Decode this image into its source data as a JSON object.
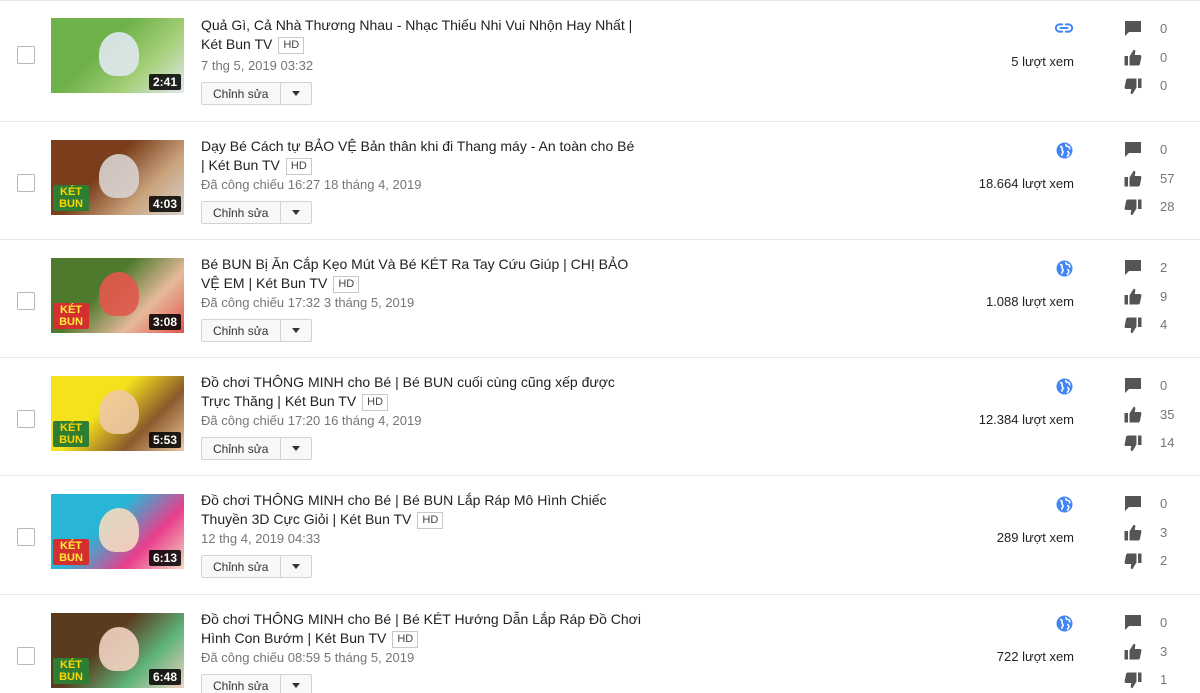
{
  "ui": {
    "edit_label": "Chỉnh sửa",
    "hd_badge": "HD",
    "accent_color": "#4285f4",
    "icon_color": "#555555"
  },
  "videos": [
    {
      "title": "Quả Gì, Cả Nhà Thương Nhau - Nhạc Thiếu Nhi Vui Nhộn Hay Nhất | Két Bun TV",
      "hd": true,
      "date": "7 thg 5, 2019 03:32",
      "duration": "2:41",
      "visibility": "unlisted",
      "visibility_icon": "link-icon",
      "views": "5 lượt xem",
      "comments": "0",
      "likes": "0",
      "dislikes": "0",
      "thumb_colors": [
        "#6fb24a",
        "#a7d07a",
        "#e0e8f0"
      ],
      "logo": ""
    },
    {
      "title": "Dạy Bé Cách tự BẢO VỆ Bản thân khi đi Thang máy - An toàn cho Bé | Két Bun TV",
      "hd": true,
      "date": "Đã công chiếu 16:27 18 tháng 4, 2019",
      "duration": "4:03",
      "visibility": "public",
      "visibility_icon": "globe-icon",
      "views": "18.664 lượt xem",
      "comments": "0",
      "likes": "57",
      "dislikes": "28",
      "thumb_colors": [
        "#7a3e1c",
        "#c9a27b",
        "#d8d3cf"
      ],
      "logo": "KÉT BUN"
    },
    {
      "title": "Bé BUN Bị Ăn Cắp Kẹo Mút Và Bé KÉT Ra Tay Cứu Giúp | CHỊ BẢO VỆ EM | Két Bun TV",
      "hd": true,
      "date": "Đã công chiếu 17:32 3 tháng 5, 2019",
      "duration": "3:08",
      "visibility": "public",
      "visibility_icon": "globe-icon",
      "views": "1.088 lượt xem",
      "comments": "2",
      "likes": "9",
      "dislikes": "4",
      "thumb_colors": [
        "#4f7a2e",
        "#e6b99a",
        "#e2574c"
      ],
      "logo": "KÉT BUN"
    },
    {
      "title": "Đồ chơi THÔNG MINH cho Bé | Bé BUN cuối cùng cũng xếp được Trực Thăng | Két Bun TV",
      "hd": true,
      "date": "Đã công chiếu 17:20 16 tháng 4, 2019",
      "duration": "5:53",
      "visibility": "public",
      "visibility_icon": "globe-icon",
      "views": "12.384 lượt xem",
      "comments": "0",
      "likes": "35",
      "dislikes": "14",
      "thumb_colors": [
        "#f5e21a",
        "#8a5a2b",
        "#f0c9a4"
      ],
      "logo": "KÉT BUN"
    },
    {
      "title": "Đồ chơi THÔNG MINH cho Bé | Bé BUN Lắp Ráp Mô Hình Chiếc Thuyền 3D Cực Giỏi | Két Bun TV",
      "hd": true,
      "date": "12 thg 4, 2019 04:33",
      "duration": "6:13",
      "visibility": "public",
      "visibility_icon": "globe-icon",
      "views": "289 lượt xem",
      "comments": "0",
      "likes": "3",
      "dislikes": "2",
      "thumb_colors": [
        "#29b6d6",
        "#e83e8c",
        "#f4d9c0"
      ],
      "logo": "KÉT BUN"
    },
    {
      "title": "Đồ chơi THÔNG MINH cho Bé | Bé KÉT Hướng Dẫn Lắp Ráp Đồ Chơi Hình Con Bướm | Két Bun TV",
      "hd": true,
      "date": "Đã công chiếu 08:59 5 tháng 5, 2019",
      "duration": "6:48",
      "visibility": "public",
      "visibility_icon": "globe-icon",
      "views": "722 lượt xem",
      "comments": "0",
      "likes": "3",
      "dislikes": "1",
      "thumb_colors": [
        "#5a3b1f",
        "#5fb37a",
        "#f2d2c2"
      ],
      "logo": "KÉT BUN"
    }
  ]
}
